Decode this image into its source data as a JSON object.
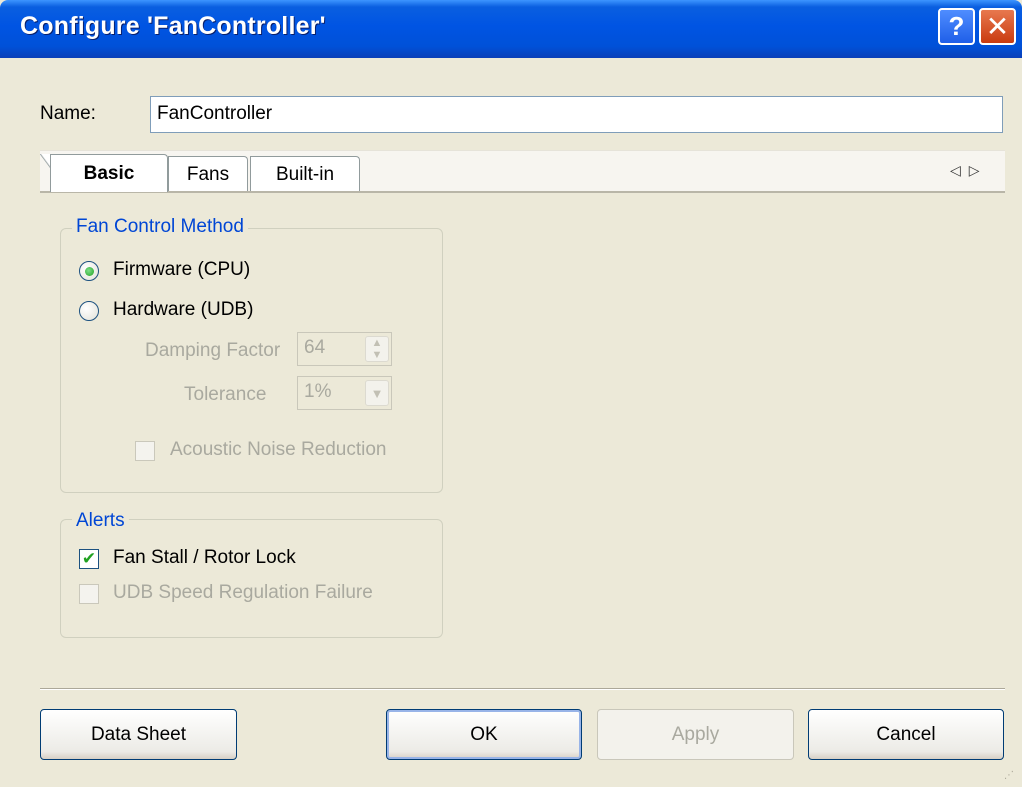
{
  "window": {
    "title": "Configure 'FanController'",
    "help_glyph": "?",
    "close_glyph": "✕"
  },
  "name_field": {
    "label": "Name:",
    "value": "FanController"
  },
  "tabs": [
    {
      "label": "Basic",
      "selected": true
    },
    {
      "label": "Fans",
      "selected": false
    },
    {
      "label": "Built-in",
      "selected": false
    }
  ],
  "tab_scroll": {
    "left": "◁",
    "right": "▷"
  },
  "fan_control": {
    "legend": "Fan Control Method",
    "options": [
      {
        "label": "Firmware (CPU)",
        "checked": true
      },
      {
        "label": "Hardware (UDB)",
        "checked": false
      }
    ],
    "damping_factor": {
      "label": "Damping Factor",
      "value": "64",
      "enabled": false
    },
    "tolerance": {
      "label": "Tolerance",
      "value": "1%",
      "enabled": false
    },
    "acoustic_noise": {
      "label": "Acoustic Noise Reduction",
      "checked": false,
      "enabled": false
    }
  },
  "alerts": {
    "legend": "Alerts",
    "items": [
      {
        "label": "Fan Stall / Rotor Lock",
        "checked": true,
        "enabled": true
      },
      {
        "label": "UDB Speed Regulation Failure",
        "checked": false,
        "enabled": false
      }
    ]
  },
  "buttons": {
    "datasheet": "Data Sheet",
    "ok": "OK",
    "apply": "Apply",
    "cancel": "Cancel"
  },
  "colors": {
    "titlebar": "#0054E3",
    "group_legend": "#0046D5",
    "check_green": "#21A121",
    "disabled_text": "#A9A99F"
  }
}
